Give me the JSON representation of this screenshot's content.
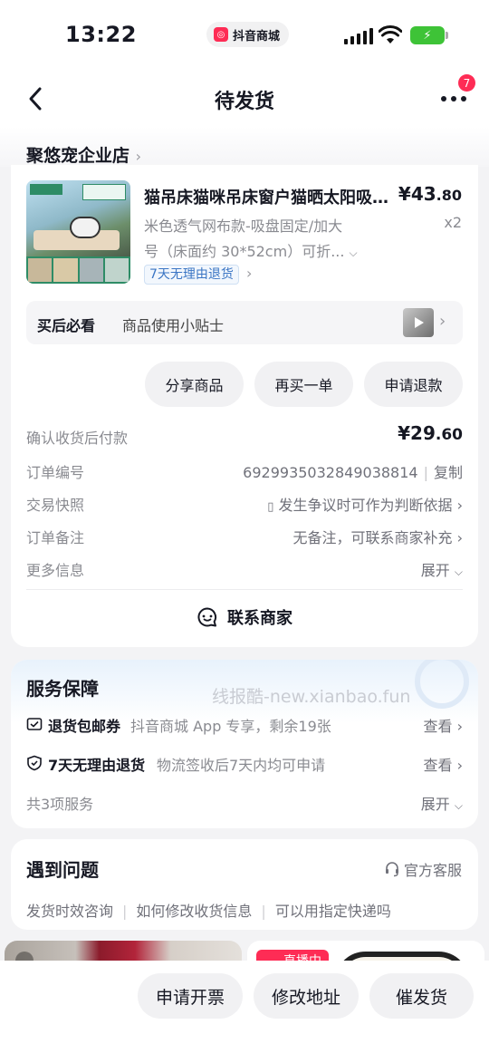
{
  "status_bar": {
    "time": "13:22",
    "app_name": "抖音商城",
    "battery_icon": "bolt-icon"
  },
  "nav": {
    "title": "待发货",
    "badge_count": "7"
  },
  "shop": {
    "name": "聚悠宠企业店"
  },
  "product": {
    "title": "猫吊床猫咪吊床窗户猫晒太阳吸盘挂窝",
    "price_int": "¥43",
    "price_dec": ".80",
    "spec_line1": "米色透气网布款-吸盘固定/加大",
    "spec_line2": "号（床面约 30*52cm）可折...",
    "qty": "x2",
    "return_tag": "7天无理由退货"
  },
  "tips": {
    "bold": "买后必看",
    "text": "商品使用小贴士"
  },
  "actions": {
    "share": "分享商品",
    "rebuy": "再买一单",
    "refund": "申请退款"
  },
  "info_rows": {
    "pay_label": "确认收货后付款",
    "pay_int": "¥29",
    "pay_dec": ".60",
    "order_label": "订单编号",
    "order_no": "6929935032849038814",
    "copy": "复制",
    "snapshot_label": "交易快照",
    "snapshot_val": "发生争议时可作为判断依据",
    "remark_label": "订单备注",
    "remark_val": "无备注，可联系商家补充",
    "more_label": "更多信息",
    "expand": "展开"
  },
  "contact": {
    "label": "联系商家"
  },
  "service": {
    "title": "服务保障",
    "watermark": "线报酷-new.xianbao.fun",
    "items": [
      {
        "name": "退货包邮券",
        "desc": "抖音商城 App 专享，剩余19张",
        "action": "查看"
      },
      {
        "name": "7天无理由退货",
        "desc": "物流签收后7天内均可申请",
        "action": "查看"
      }
    ],
    "summary": "共3项服务",
    "expand": "展开"
  },
  "problems": {
    "title": "遇到问题",
    "cs": "官方客服",
    "links": [
      "发货时效咨询",
      "如何修改收货信息",
      "可以用指定快递吗"
    ]
  },
  "reco": {
    "live_label": "直播中"
  },
  "bottom_bar": {
    "invoice": "申请开票",
    "address": "修改地址",
    "urge": "催发货"
  },
  "colors": {
    "accent": "#fe2c55",
    "link_blue": "#3a75c4",
    "battery": "#3ec337"
  }
}
